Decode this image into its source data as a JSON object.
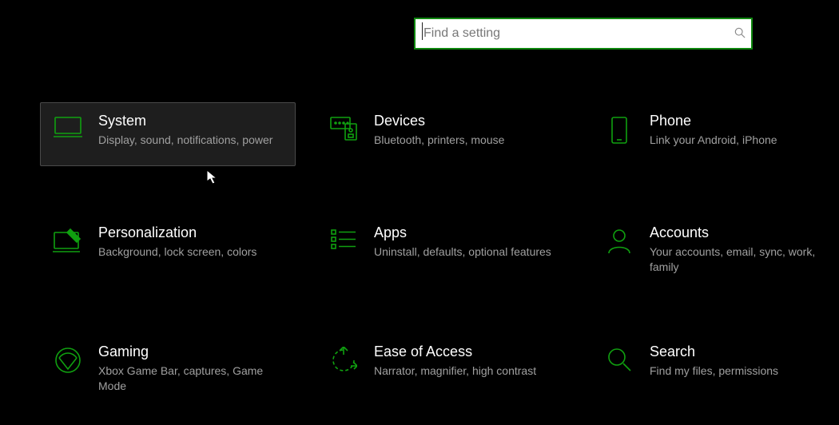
{
  "search": {
    "placeholder": "Find a setting"
  },
  "tiles": {
    "system": {
      "title": "System",
      "desc": "Display, sound, notifications, power"
    },
    "devices": {
      "title": "Devices",
      "desc": "Bluetooth, printers, mouse"
    },
    "phone": {
      "title": "Phone",
      "desc": "Link your Android, iPhone"
    },
    "personalization": {
      "title": "Personalization",
      "desc": "Background, lock screen, colors"
    },
    "apps": {
      "title": "Apps",
      "desc": "Uninstall, defaults, optional features"
    },
    "accounts": {
      "title": "Accounts",
      "desc": "Your accounts, email, sync, work, family"
    },
    "gaming": {
      "title": "Gaming",
      "desc": "Xbox Game Bar, captures, Game Mode"
    },
    "ease_of_access": {
      "title": "Ease of Access",
      "desc": "Narrator, magnifier, high contrast"
    },
    "search": {
      "title": "Search",
      "desc": "Find my files, permissions"
    }
  },
  "colors": {
    "accent": "#10a010"
  }
}
